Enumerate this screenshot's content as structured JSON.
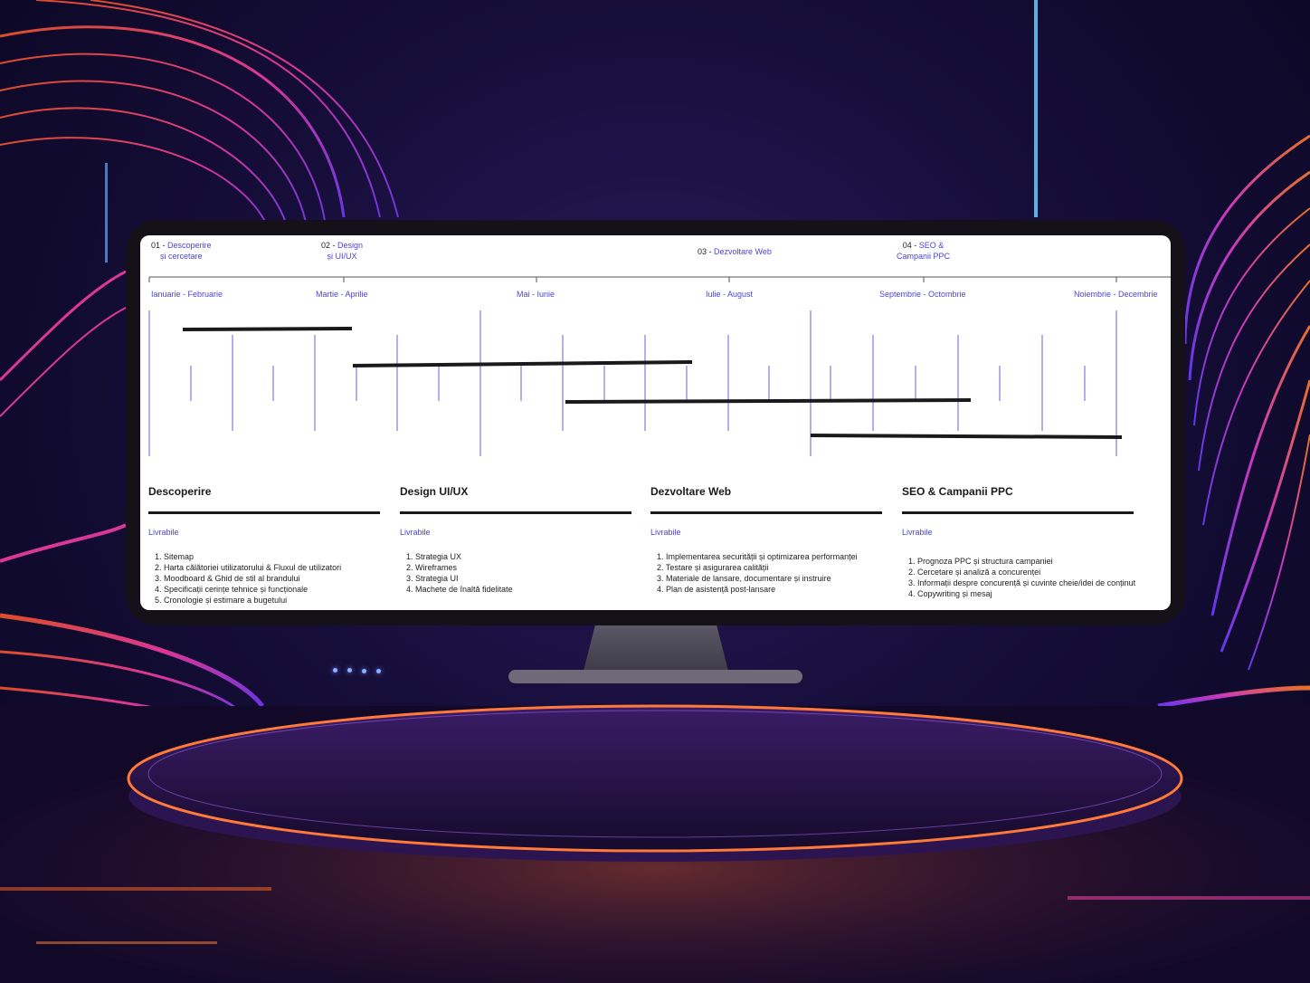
{
  "colors": {
    "accent": "#4b45d6",
    "bar": "#1a1a1a",
    "grid": "#6a62e0"
  },
  "phases": [
    {
      "num": "01 - ",
      "name_line1": "Descoperire",
      "name_line2": "și cercetare"
    },
    {
      "num": "02 - ",
      "name_line1": "Design",
      "name_line2": "și UI/UX"
    },
    {
      "num": "03 - ",
      "name_line1": "Dezvoltare Web",
      "name_line2": ""
    },
    {
      "num": "04 - ",
      "name_line1": "SEO &",
      "name_line2": "Campanii PPC"
    }
  ],
  "months": [
    "Ianuarie - Februarie",
    "Martie - Aprilie",
    "Mai - Iunie",
    "Iulie - August",
    "Septembrie - Octombrie",
    "Noiembrie - Decembrie"
  ],
  "columns": [
    {
      "title": "Descoperire",
      "deliverables_label": "Livrabile",
      "items": [
        "1.  Sitemap",
        "2.  Harta călătoriei utilizatorului & Fluxul de utilizatori",
        "3.  Moodboard & Ghid de stil al brandului",
        "4.  Specificații cerințe tehnice și funcționale",
        "5.  Cronologie și estimare a bugetului"
      ]
    },
    {
      "title": "Design UI/UX",
      "deliverables_label": "Livrabile",
      "items": [
        "1.  Strategia UX",
        "2.  Wireframes",
        "3.  Strategia UI",
        "4.  Machete de înaltă fidelitate"
      ]
    },
    {
      "title": "Dezvoltare Web",
      "deliverables_label": "Livrabile",
      "items": [
        "1.  Implementarea securității și optimizarea performanței",
        "2.  Testare și asigurarea calității",
        "3.  Materiale de lansare, documentare și instruire",
        "4.  Plan de asistență post-lansare"
      ]
    },
    {
      "title": "SEO & Campanii PPC",
      "deliverables_label": "Livrabile",
      "items": [
        "1.  Prognoza PPC și structura campaniei",
        "2.  Cercetare și analiză a concurenței",
        "3.  Informații despre concurență și cuvinte cheie/idei de conținut",
        "4.  Copywriting și mesaj"
      ]
    }
  ]
}
